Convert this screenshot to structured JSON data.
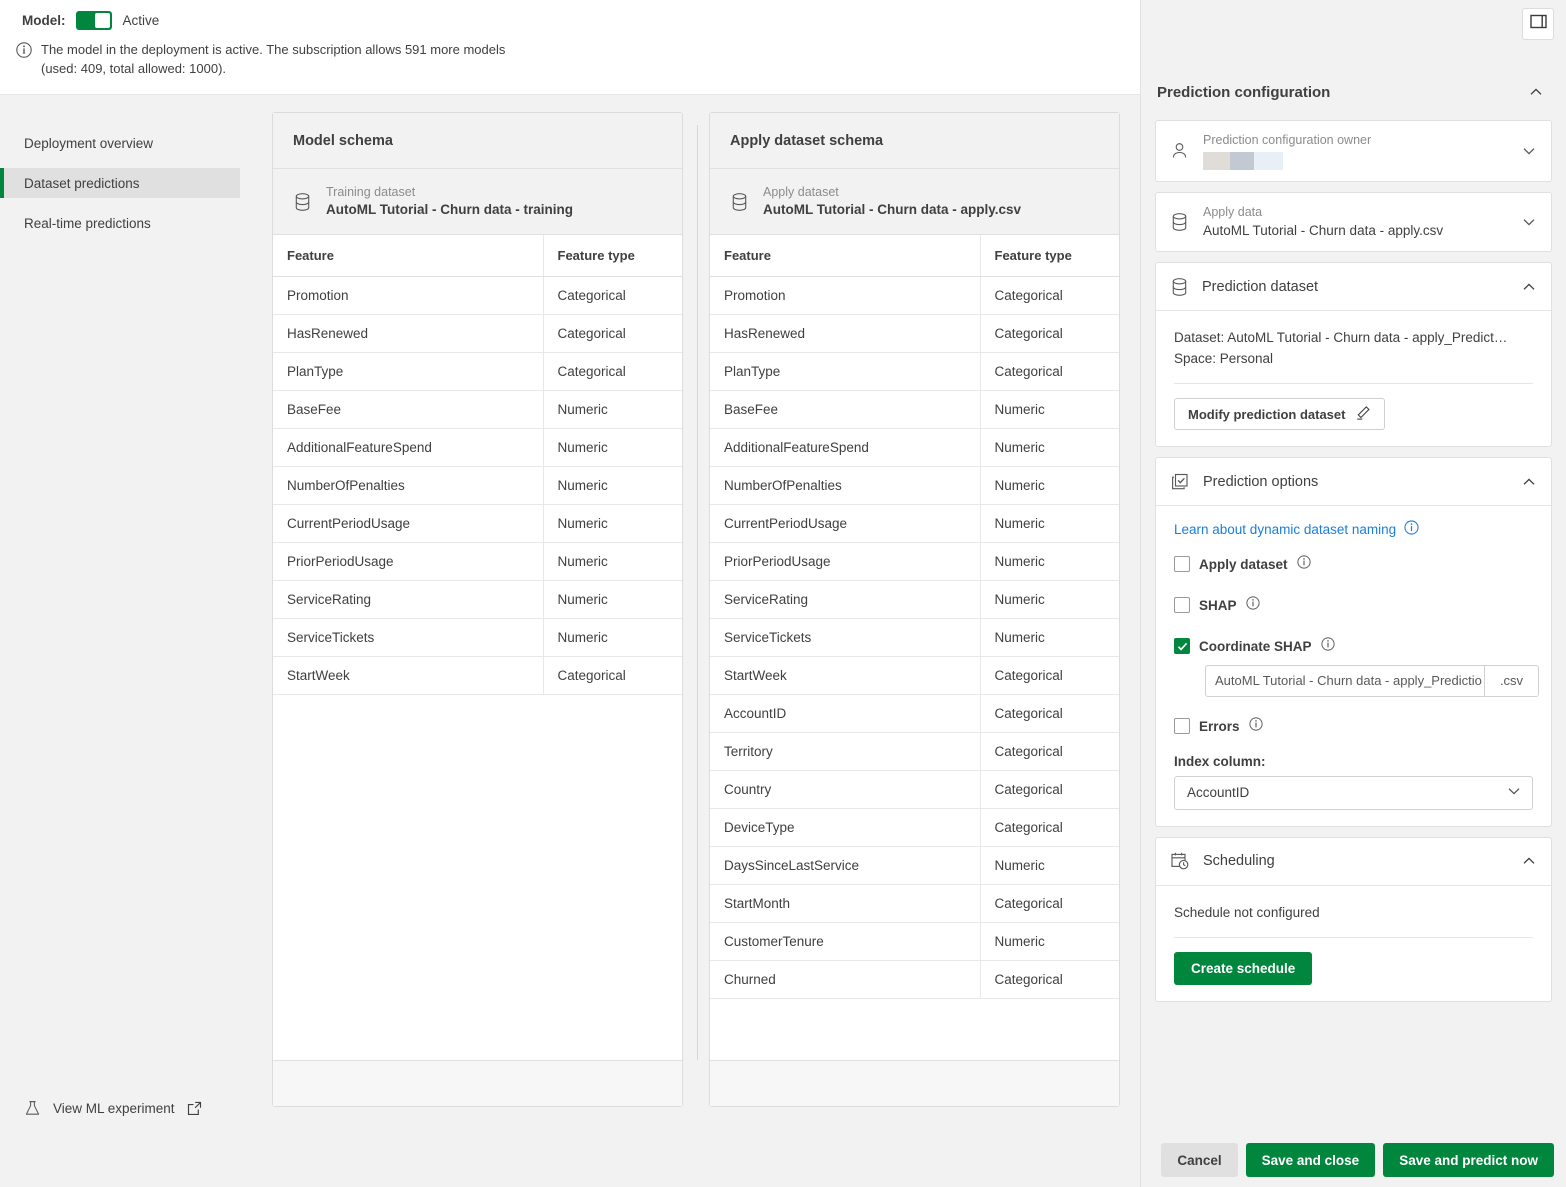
{
  "topbar": {
    "model_label": "Model:",
    "toggle_state_text": "Active",
    "info_line1": "The model in the deployment is active. The subscription allows 591 more models",
    "info_line2": "(used: 409, total allowed: 1000)."
  },
  "sidebar": {
    "items": [
      {
        "label": "Deployment overview",
        "active": false
      },
      {
        "label": "Dataset predictions",
        "active": true
      },
      {
        "label": "Real-time predictions",
        "active": false
      }
    ],
    "ml_experiment_label": "View ML experiment"
  },
  "model_schema": {
    "title": "Model schema",
    "dataset_kind": "Training dataset",
    "dataset_name": "AutoML Tutorial - Churn data - training",
    "columns": [
      "Feature",
      "Feature type"
    ],
    "rows": [
      [
        "Promotion",
        "Categorical"
      ],
      [
        "HasRenewed",
        "Categorical"
      ],
      [
        "PlanType",
        "Categorical"
      ],
      [
        "BaseFee",
        "Numeric"
      ],
      [
        "AdditionalFeatureSpend",
        "Numeric"
      ],
      [
        "NumberOfPenalties",
        "Numeric"
      ],
      [
        "CurrentPeriodUsage",
        "Numeric"
      ],
      [
        "PriorPeriodUsage",
        "Numeric"
      ],
      [
        "ServiceRating",
        "Numeric"
      ],
      [
        "ServiceTickets",
        "Numeric"
      ],
      [
        "StartWeek",
        "Categorical"
      ]
    ]
  },
  "apply_schema": {
    "title": "Apply dataset schema",
    "dataset_kind": "Apply dataset",
    "dataset_name": "AutoML Tutorial - Churn data - apply.csv",
    "columns": [
      "Feature",
      "Feature type"
    ],
    "rows": [
      [
        "Promotion",
        "Categorical"
      ],
      [
        "HasRenewed",
        "Categorical"
      ],
      [
        "PlanType",
        "Categorical"
      ],
      [
        "BaseFee",
        "Numeric"
      ],
      [
        "AdditionalFeatureSpend",
        "Numeric"
      ],
      [
        "NumberOfPenalties",
        "Numeric"
      ],
      [
        "CurrentPeriodUsage",
        "Numeric"
      ],
      [
        "PriorPeriodUsage",
        "Numeric"
      ],
      [
        "ServiceRating",
        "Numeric"
      ],
      [
        "ServiceTickets",
        "Numeric"
      ],
      [
        "StartWeek",
        "Categorical"
      ],
      [
        "AccountID",
        "Categorical"
      ],
      [
        "Territory",
        "Categorical"
      ],
      [
        "Country",
        "Categorical"
      ],
      [
        "DeviceType",
        "Categorical"
      ],
      [
        "DaysSinceLastService",
        "Numeric"
      ],
      [
        "StartMonth",
        "Categorical"
      ],
      [
        "CustomerTenure",
        "Numeric"
      ],
      [
        "Churned",
        "Categorical"
      ]
    ]
  },
  "right_panel": {
    "title": "Prediction configuration",
    "owner": {
      "label": "Prediction configuration owner",
      "value": ""
    },
    "apply_data": {
      "label": "Apply data",
      "value": "AutoML Tutorial - Churn data - apply.csv"
    },
    "prediction_dataset": {
      "title": "Prediction dataset",
      "dataset_line": "Dataset: AutoML Tutorial - Churn data - apply_Predict…",
      "space_line": "Space: Personal",
      "modify_button": "Modify prediction dataset"
    },
    "prediction_options": {
      "title": "Prediction options",
      "link_text": "Learn about dynamic dataset naming",
      "checkboxes": [
        {
          "label": "Apply dataset",
          "checked": false
        },
        {
          "label": "SHAP",
          "checked": false
        },
        {
          "label": "Coordinate SHAP",
          "checked": true
        },
        {
          "label": "Errors",
          "checked": false
        }
      ],
      "coordinate_shap_filename": "AutoML Tutorial - Churn data - apply_Predictio",
      "coordinate_shap_extension": ".csv",
      "index_column_label": "Index column:",
      "index_column_value": "AccountID"
    },
    "scheduling": {
      "title": "Scheduling",
      "status": "Schedule not configured",
      "create_button": "Create schedule"
    }
  },
  "footer": {
    "cancel": "Cancel",
    "save_and_close": "Save and close",
    "save_and_predict": "Save and predict now"
  },
  "colors": {
    "accent_green": "#00873d",
    "link_blue": "#1a7ee0",
    "panel_bg": "#f2f2f2",
    "text": "#404040",
    "muted": "#8c8c8c"
  }
}
